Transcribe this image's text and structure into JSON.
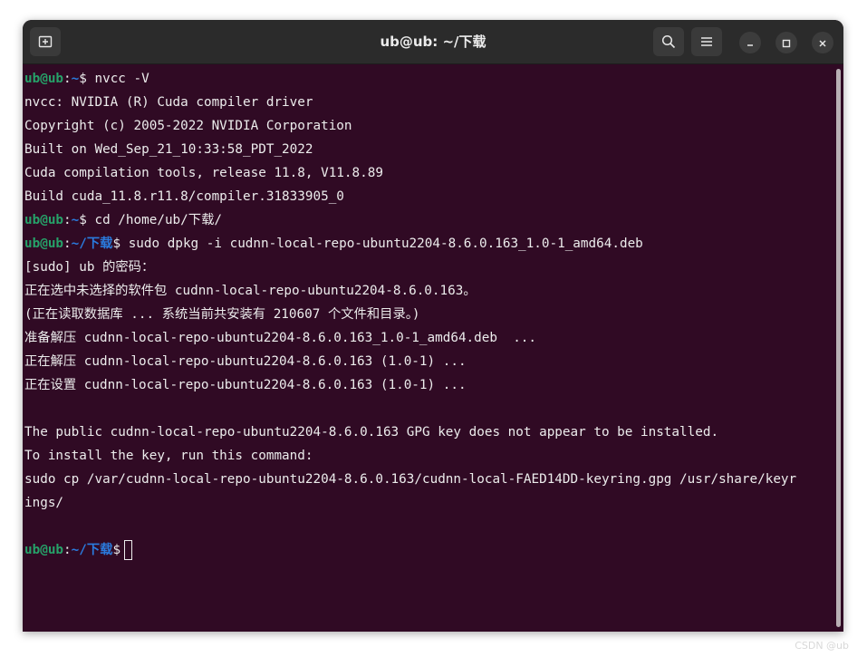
{
  "window": {
    "title": "ub@ub: ~/下载"
  },
  "colors": {
    "background": "#300a24",
    "user": "#26a269",
    "path": "#2a7bde",
    "text": "#ececec"
  },
  "icons": {
    "new_tab": "new-tab-icon",
    "search": "search-icon",
    "menu": "hamburger-menu-icon",
    "minimize": "minimize-icon",
    "maximize": "maximize-icon",
    "close": "close-icon"
  },
  "terminal": {
    "lines": [
      {
        "user": "ub@ub",
        "sep": ":",
        "path": "~",
        "dollar": "$ ",
        "cmd": "nvcc -V"
      },
      {
        "text": "nvcc: NVIDIA (R) Cuda compiler driver"
      },
      {
        "text": "Copyright (c) 2005-2022 NVIDIA Corporation"
      },
      {
        "text": "Built on Wed_Sep_21_10:33:58_PDT_2022"
      },
      {
        "text": "Cuda compilation tools, release 11.8, V11.8.89"
      },
      {
        "text": "Build cuda_11.8.r11.8/compiler.31833905_0"
      },
      {
        "user": "ub@ub",
        "sep": ":",
        "path": "~",
        "dollar": "$ ",
        "cmd": "cd /home/ub/下载/"
      },
      {
        "user": "ub@ub",
        "sep": ":",
        "path": "~/下载",
        "dollar": "$ ",
        "cmd": "sudo dpkg -i cudnn-local-repo-ubuntu2204-8.6.0.163_1.0-1_amd64.deb"
      },
      {
        "text": "[sudo] ub 的密码："
      },
      {
        "text": "正在选中未选择的软件包 cudnn-local-repo-ubuntu2204-8.6.0.163。"
      },
      {
        "text": "(正在读取数据库 ... 系统当前共安装有 210607 个文件和目录。)"
      },
      {
        "text": "准备解压 cudnn-local-repo-ubuntu2204-8.6.0.163_1.0-1_amd64.deb  ..."
      },
      {
        "text": "正在解压 cudnn-local-repo-ubuntu2204-8.6.0.163 (1.0-1) ..."
      },
      {
        "text": "正在设置 cudnn-local-repo-ubuntu2204-8.6.0.163 (1.0-1) ..."
      },
      {
        "text": ""
      },
      {
        "text": "The public cudnn-local-repo-ubuntu2204-8.6.0.163 GPG key does not appear to be installed."
      },
      {
        "text": "To install the key, run this command:"
      },
      {
        "text": "sudo cp /var/cudnn-local-repo-ubuntu2204-8.6.0.163/cudnn-local-FAED14DD-keyring.gpg /usr/share/keyr"
      },
      {
        "text": "ings/"
      },
      {
        "text": ""
      },
      {
        "user": "ub@ub",
        "sep": ":",
        "path": "~/下载",
        "dollar": "$",
        "cmd": "",
        "cursor": true
      }
    ]
  },
  "watermark": "CSDN @ub"
}
